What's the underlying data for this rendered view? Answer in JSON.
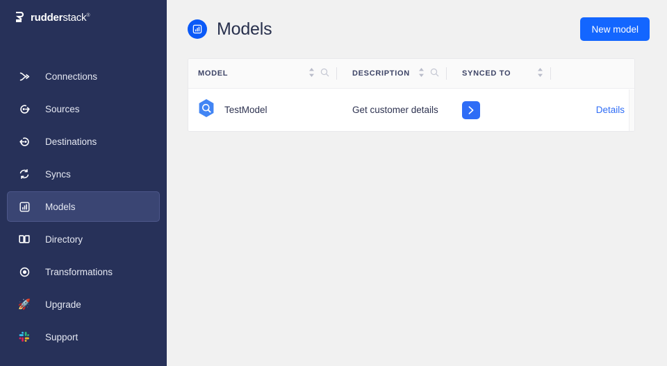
{
  "brand": {
    "name_bold": "rudder",
    "name_light": "stack",
    "tm": "®"
  },
  "sidebar": {
    "items": [
      {
        "label": "Connections",
        "icon": "connections-icon",
        "active": false
      },
      {
        "label": "Sources",
        "icon": "sources-icon",
        "active": false
      },
      {
        "label": "Destinations",
        "icon": "destinations-icon",
        "active": false
      },
      {
        "label": "Syncs",
        "icon": "syncs-icon",
        "active": false
      },
      {
        "label": "Models",
        "icon": "models-icon",
        "active": true
      },
      {
        "label": "Directory",
        "icon": "directory-icon",
        "active": false
      },
      {
        "label": "Transformations",
        "icon": "transformations-icon",
        "active": false
      },
      {
        "label": "Upgrade",
        "icon": "rocket-icon",
        "emoji": "🚀",
        "active": false
      },
      {
        "label": "Support",
        "icon": "slack-icon",
        "active": false
      }
    ]
  },
  "header": {
    "title": "Models",
    "icon": "models-chart-icon",
    "new_model_label": "New model",
    "accent_color": "#1366ff"
  },
  "table": {
    "columns": [
      {
        "label": "MODEL",
        "sortable": true,
        "searchable": true
      },
      {
        "label": "DESCRIPTION",
        "sortable": true,
        "searchable": true
      },
      {
        "label": "SYNCED TO",
        "sortable": true,
        "searchable": false
      }
    ],
    "rows": [
      {
        "model_name": "TestModel",
        "model_icon": "bigquery-icon",
        "description": "Get customer details",
        "synced_to_icon": "braze-icon",
        "details_label": "Details"
      }
    ]
  }
}
